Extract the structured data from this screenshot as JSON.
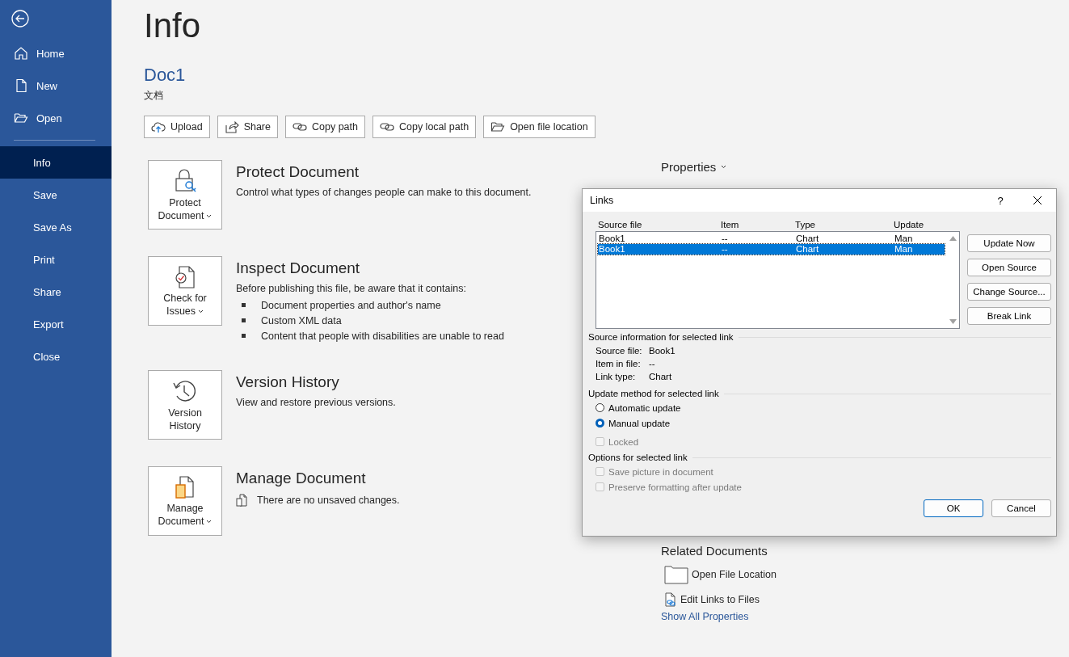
{
  "sidebar": {
    "nav": [
      {
        "label": "Home",
        "kind": "home",
        "selected": false
      },
      {
        "label": "New",
        "kind": "new",
        "selected": false
      },
      {
        "label": "Open",
        "kind": "open",
        "selected": false
      }
    ],
    "items": [
      {
        "label": "Info",
        "selected": true
      },
      {
        "label": "Save",
        "selected": false
      },
      {
        "label": "Save As",
        "selected": false
      },
      {
        "label": "Print",
        "selected": false
      },
      {
        "label": "Share",
        "selected": false
      },
      {
        "label": "Export",
        "selected": false
      },
      {
        "label": "Close",
        "selected": false
      }
    ]
  },
  "page": {
    "title": "Info",
    "doc_name": "Doc1",
    "doc_type": "文档",
    "actions": [
      {
        "label": "Upload",
        "kind": "upload"
      },
      {
        "label": "Share",
        "kind": "share"
      },
      {
        "label": "Copy path",
        "kind": "link"
      },
      {
        "label": "Copy local path",
        "kind": "link"
      },
      {
        "label": "Open file location",
        "kind": "folder"
      }
    ]
  },
  "sections": [
    {
      "kind": "lock",
      "button_lines": [
        "Protect",
        "Document"
      ],
      "title": "Protect Document",
      "description": "Control what types of changes people can make to this document."
    },
    {
      "kind": "check",
      "button_lines": [
        "Check for",
        "Issues"
      ],
      "title": "Inspect Document",
      "description": "Before publishing this file, be aware that it contains:",
      "bullets": [
        "Document properties and author's name",
        "Custom XML data",
        "Content that people with disabilities are unable to read"
      ]
    },
    {
      "kind": "history",
      "button_lines": [
        "Version",
        "History"
      ],
      "title": "Version History",
      "description": "View and restore previous versions."
    },
    {
      "kind": "manage",
      "button_lines": [
        "Manage",
        "Document"
      ],
      "title": "Manage Document",
      "status": "There are no unsaved changes."
    }
  ],
  "properties": {
    "title": "Properties"
  },
  "related": {
    "title": "Related Documents",
    "items": [
      {
        "label": "Open File Location",
        "kind": "folder"
      },
      {
        "label": "Edit Links to Files",
        "kind": "linkdoc"
      }
    ],
    "link": "Show All Properties"
  },
  "dialog": {
    "title": "Links",
    "help": "?",
    "columns": [
      "Source file",
      "Item",
      "Type",
      "Update"
    ],
    "rows": [
      {
        "cells": [
          "Book1",
          "--",
          "Chart",
          "Man"
        ],
        "selected": false
      },
      {
        "cells": [
          "Book1",
          "--",
          "Chart",
          "Man"
        ],
        "selected": true
      }
    ],
    "buttons": [
      "Update Now",
      "Open Source",
      "Change Source...",
      "Break Link"
    ],
    "source_info": {
      "heading": "Source information for selected link",
      "fields": [
        {
          "label": "Source file:",
          "value": "Book1"
        },
        {
          "label": "Item in file:",
          "value": "--"
        },
        {
          "label": "Link type:",
          "value": "Chart"
        }
      ]
    },
    "update_method": {
      "heading": "Update method for selected link",
      "options": [
        {
          "label": "Automatic update",
          "selected": false
        },
        {
          "label": "Manual update",
          "selected": true
        }
      ],
      "locked": {
        "label": "Locked",
        "checked": false,
        "disabled": true
      }
    },
    "options": {
      "heading": "Options for selected link",
      "checks": [
        {
          "label": "Save picture in document",
          "checked": false,
          "disabled": true
        },
        {
          "label": "Preserve formatting after update",
          "checked": false,
          "disabled": true
        }
      ]
    },
    "ok": "OK",
    "cancel": "Cancel"
  }
}
